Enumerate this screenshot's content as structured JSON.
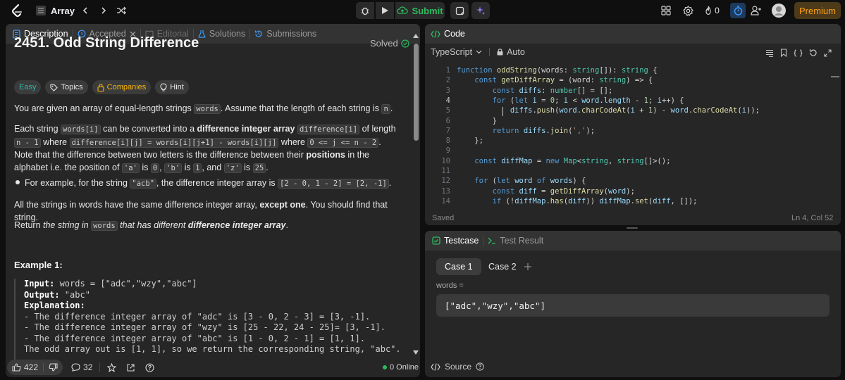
{
  "topbar": {
    "problem_list_label": "Array",
    "submit_label": "Submit",
    "streak_count": "0",
    "premium_label": "Premium"
  },
  "desc_tabs": {
    "description": "Description",
    "accepted": "Accepted",
    "editorial": "Editorial",
    "solutions": "Solutions",
    "submissions": "Submissions"
  },
  "problem": {
    "title": "2451. Odd String Difference",
    "status": "Solved",
    "tags": {
      "difficulty": "Easy",
      "topics": "Topics",
      "companies": "Companies",
      "hint": "Hint"
    },
    "p1_a": "You are given an array of equal-length strings ",
    "p1_code": "words",
    "p1_b": ". Assume that the length of each string is ",
    "p1_code2": "n",
    "p1_c": ".",
    "p2_a": "Each string ",
    "p2_c1": "words[i]",
    "p2_b": " can be converted into a ",
    "p2_bold1": "difference integer array",
    "p2_c2": "difference[i]",
    "p2_d": " of length ",
    "p2_c3": "n - 1",
    "p2_e": " where ",
    "p2_c4": "difference[i][j] = words[i][j+1] - words[i][j]",
    "p2_f": " where ",
    "p2_c5": "0 <= j <= n - 2",
    "p2_g": ". Note that the difference between two letters is the difference between their ",
    "p2_bold2": "positions",
    "p2_h": " in the alphabet i.e. the position of ",
    "p2_c6": "'a'",
    "p2_i": " is ",
    "p2_c7": "0",
    "p2_j": ", ",
    "p2_c8": "'b'",
    "p2_k": " is ",
    "p2_c9": "1",
    "p2_l": ", and ",
    "p2_c10": "'z'",
    "p2_m": " is ",
    "p2_c11": "25",
    "p2_n": ".",
    "bullet_a": "For example, for the string ",
    "bullet_c1": "\"acb\"",
    "bullet_b": ", the difference integer array is ",
    "bullet_c2": "[2 - 0, 1 - 2] = [2, -1]",
    "bullet_c": ".",
    "p3_a": "All the strings in words have the same difference integer array, ",
    "p3_bold": "except one",
    "p3_b": ". You should find that string.",
    "p4_a": "Return ",
    "p4_i1": "the string in ",
    "p4_code": "words",
    "p4_i2": " that has different ",
    "p4_bi": "difference integer array",
    "p4_b": ".",
    "example_title": "Example 1:",
    "example_lines": {
      "input_label": "Input:",
      "input_value": " words = [\"adc\",\"wzy\",\"abc\"]",
      "output_label": "Output:",
      "output_value": " \"abc\"",
      "expl_label": "Explanation:",
      "l1": "- The difference integer array of \"adc\" is [3 - 0, 2 - 3] = [3, -1].",
      "l2": "- The difference integer array of \"wzy\" is [25 - 22, 24 - 25]= [3, -1].",
      "l3": "- The difference integer array of \"abc\" is [1 - 0, 2 - 1] = [1, 1].",
      "l4": "The odd array out is [1, 1], so we return the corresponding string, \"abc\"."
    }
  },
  "footer": {
    "likes": "422",
    "comments": "32",
    "online": "0 Online"
  },
  "code_panel": {
    "tab_label": "Code",
    "language": "TypeScript",
    "mode": "Auto",
    "saved": "Saved",
    "cursor": "Ln 4, Col 52",
    "line_numbers": [
      "1",
      "2",
      "3",
      "4",
      "5",
      "6",
      "7",
      "8",
      "9",
      "10",
      "11",
      "12",
      "13",
      "14"
    ]
  },
  "testcase_panel": {
    "tab_testcase": "Testcase",
    "tab_result": "Test Result",
    "case1": "Case 1",
    "case2": "Case 2",
    "var_label": "words =",
    "var_value": "[\"adc\",\"wzy\",\"abc\"]"
  },
  "bottom": {
    "source_label": "Source"
  },
  "colors": {
    "accent_green": "#2cbb5d",
    "premium_orange": "#ffa116",
    "easy_teal": "#2ab8b1",
    "companies_yellow": "#ffb700"
  }
}
